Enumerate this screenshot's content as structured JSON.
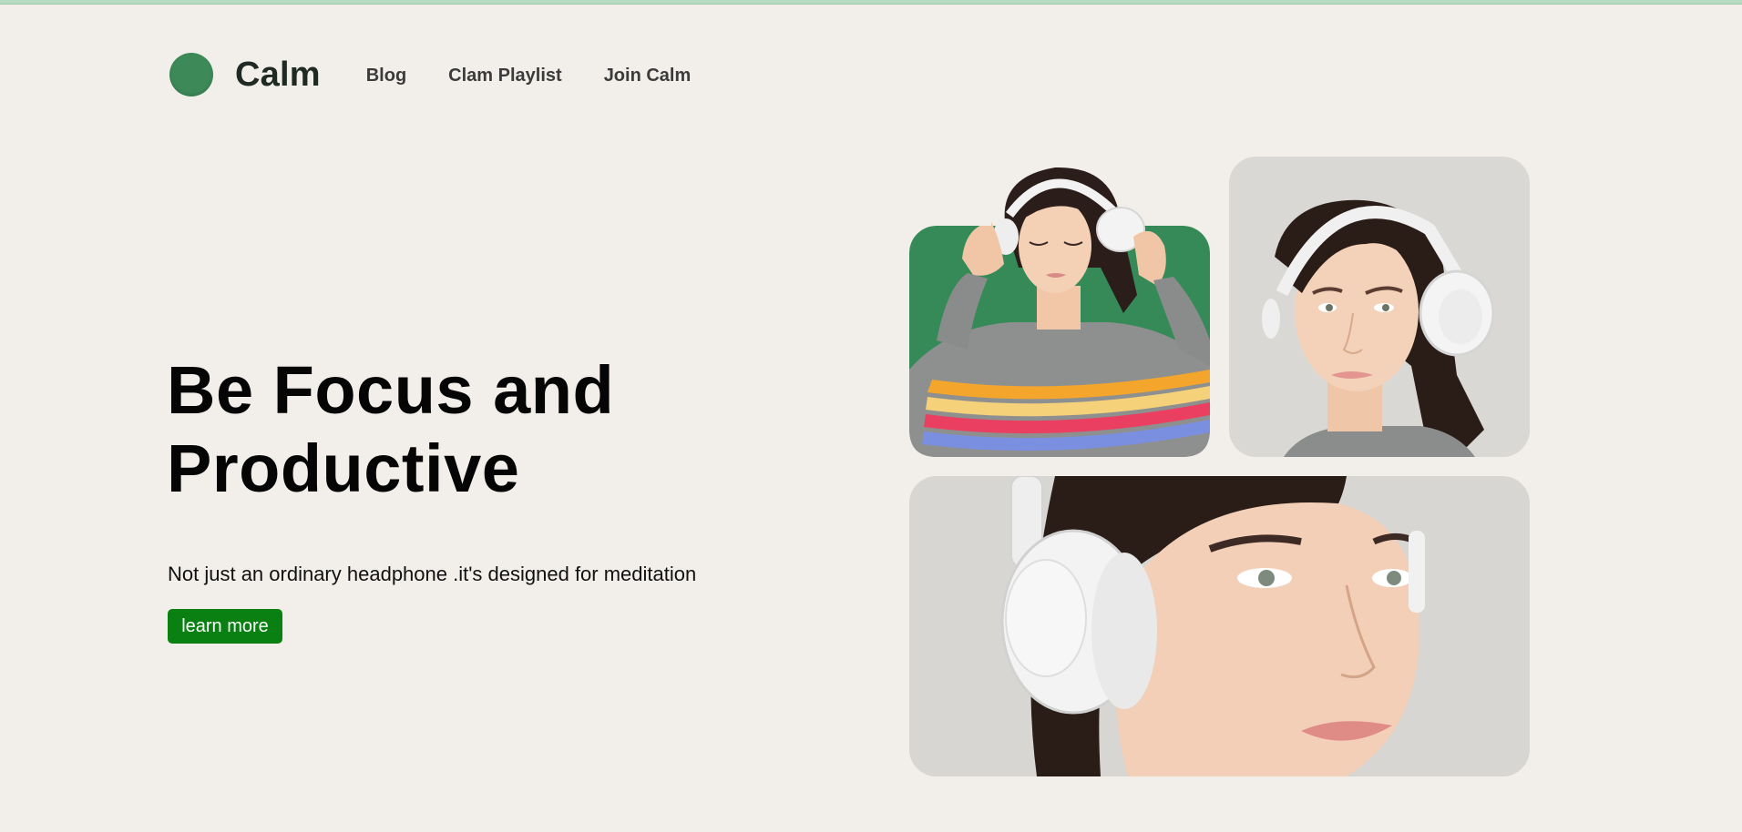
{
  "brand": {
    "name": "Calm",
    "logo_color": "#3d8a58"
  },
  "nav": {
    "items": [
      {
        "label": "Blog"
      },
      {
        "label": "Clam Playlist"
      },
      {
        "label": "Join Calm"
      }
    ]
  },
  "hero": {
    "title_line1": "Be Focus and",
    "title_line2": "Productive",
    "subtitle": "Not just an ordinary headphone .it's designed for meditation",
    "cta_label": "learn more",
    "cta_color": "#0a8012"
  },
  "gallery": {
    "images": [
      {
        "icon": "woman-headphones-green-photo"
      },
      {
        "icon": "woman-headphones-side-photo"
      },
      {
        "icon": "woman-headphones-closeup-photo"
      }
    ]
  }
}
